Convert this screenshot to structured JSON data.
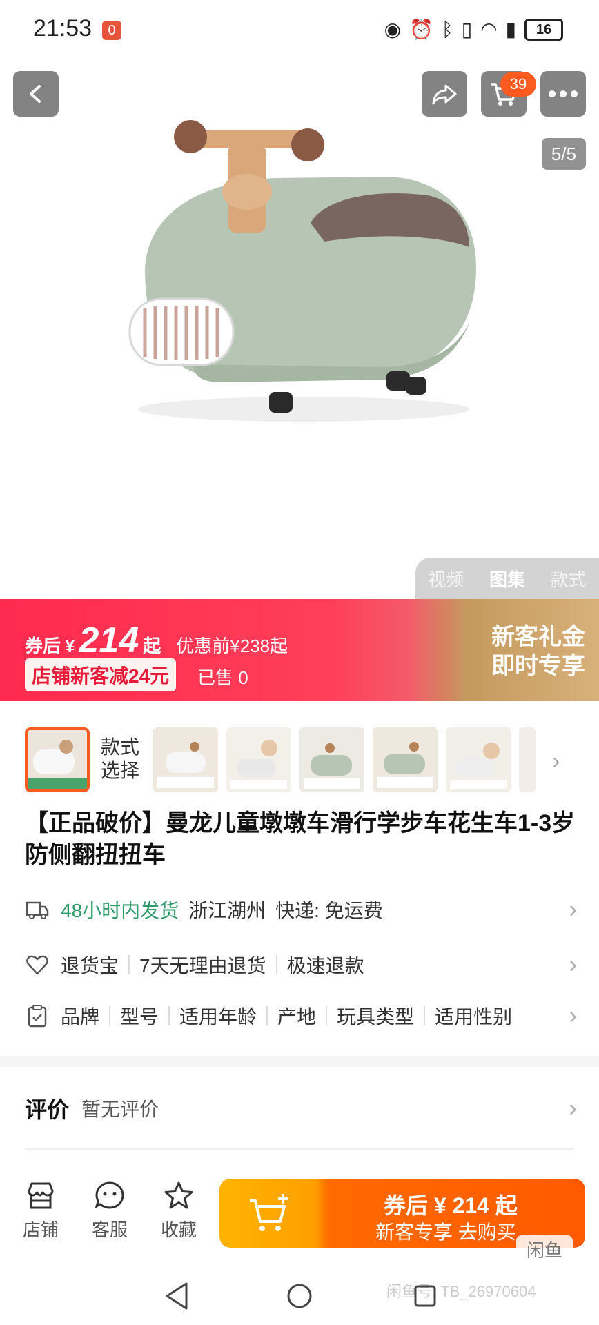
{
  "status_bar": {
    "time": "21:53",
    "notif_badge": "0",
    "battery": "16",
    "icons": [
      "eye-icon",
      "alarm-icon",
      "bluetooth-icon",
      "vibrate-icon",
      "wifi-icon",
      "signal-icon"
    ]
  },
  "gallery": {
    "cart_count": "39",
    "page_indicator": "5/5",
    "media_tabs": [
      "视频",
      "图集",
      "款式"
    ],
    "active_tab_index": 1,
    "product_colors": {
      "body": "#b8c7b5",
      "seat": "#7a6660",
      "wood": "#d9a77a"
    }
  },
  "price_banner": {
    "label": "券后",
    "currency": "¥",
    "price": "214",
    "qi": "起",
    "original": "优惠前¥238起",
    "coupon": "店铺新客减24元",
    "sold": "已售 0",
    "promo_line1": "新客礼金",
    "promo_line2": "即时专享"
  },
  "style_selector": {
    "label_line1": "款式",
    "label_line2": "选择",
    "thumbnail_count": 5
  },
  "product": {
    "title": "【正品破价】曼龙儿童墩墩车滑行学步车花生车1-3岁防侧翻扭扭车"
  },
  "shipping": {
    "fast": "48小时内发货",
    "origin": "浙江湖州",
    "delivery": "快递: 免运费"
  },
  "returns": {
    "items": [
      "退货宝",
      "7天无理由退货",
      "极速退款"
    ]
  },
  "params": {
    "items": [
      "品牌",
      "型号",
      "适用年龄",
      "产地",
      "玩具类型",
      "适用性别"
    ]
  },
  "review": {
    "title": "评价",
    "value": "暂无评价"
  },
  "bottom_bar": {
    "shop": "店铺",
    "service": "客服",
    "favorite": "收藏",
    "buy_line1": "券后 ¥ 214 起",
    "buy_line2": "新客专享  去购买"
  },
  "watermark": "闲鱼",
  "user_tag": "闲鱼号: TB_26970604"
}
